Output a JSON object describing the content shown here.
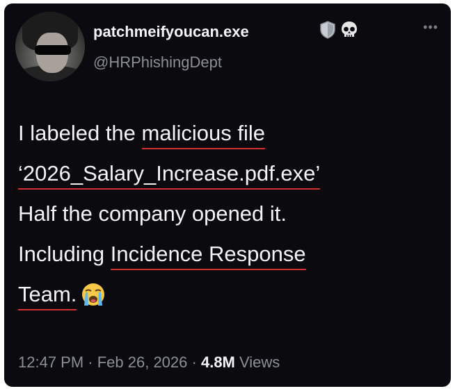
{
  "author": {
    "display_name": "patchmeifyoucan.exe",
    "handle": "@HRPhishingDept"
  },
  "header": {
    "more_label": "•••"
  },
  "post": {
    "line1_pre": "I labeled the ",
    "line1_ul": "malicious file",
    "line2_ul": "‘2026_Salary_Increase.pdf.exe’",
    "line3": "Half the company opened it.",
    "line4_pre": "Including ",
    "line4_ul": "Incidence Response",
    "line5_ul": "Team.",
    "line5_emoji": "😭"
  },
  "meta": {
    "time": "12:47 PM",
    "sep1": " · ",
    "date": "Feb 26, 2026",
    "sep2": " · ",
    "views_count": "4.8M",
    "views_label": " Views"
  },
  "colors": {
    "background": "#0b0b0f",
    "underline": "#d43030",
    "secondary_text": "#8b8f96"
  },
  "icons": [
    "shield-icon",
    "skull-icon",
    "more-icon",
    "crying-face-icon"
  ]
}
